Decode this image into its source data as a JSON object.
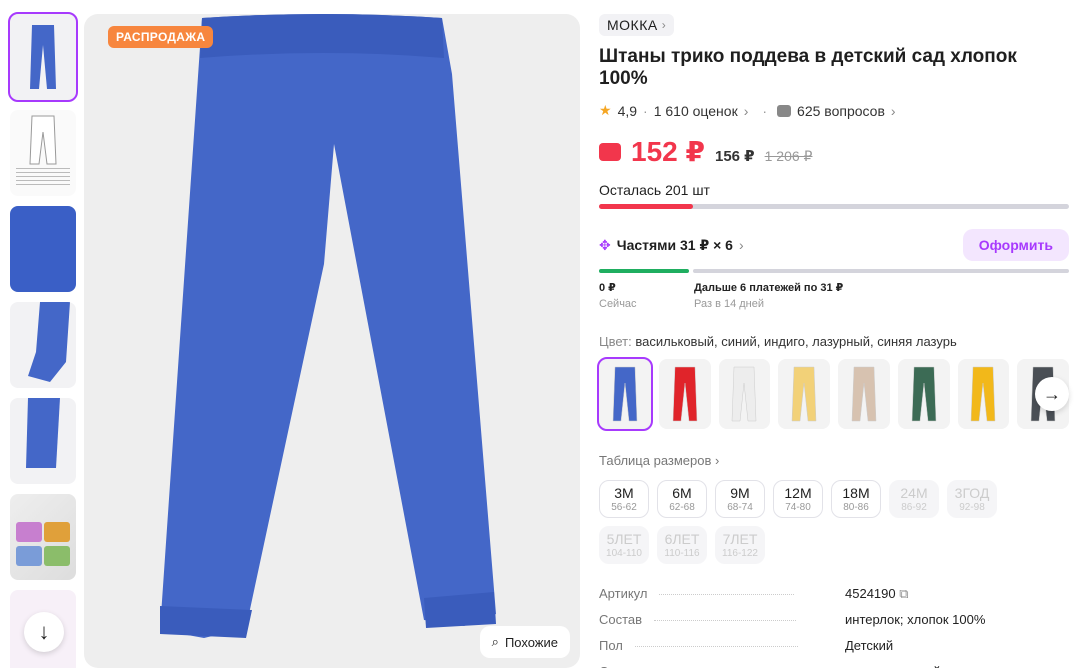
{
  "colors": {
    "accent": "#a73afd",
    "price": "#f2364c",
    "sale": "#f7863e",
    "pay_green": "#1fae60",
    "product_blue": "#4467c8"
  },
  "thumbnails": [
    "blue-pants",
    "size-chart",
    "fabric-closeup",
    "cuff-closeup",
    "cuff-closeup-2",
    "kids-photo-collage",
    "promo-card"
  ],
  "main_image": {
    "sale_badge": "РАСПРОДАЖА",
    "similar_button": "Похожие"
  },
  "brand": "МОККА",
  "title": "Штаны трико поддева в детский сад хлопок 100%",
  "rating": {
    "value": "4,9",
    "reviews": "1 610 оценок",
    "questions": "625 вопросов"
  },
  "price": {
    "current": "152 ₽",
    "alt": "156 ₽",
    "old": "1 206 ₽"
  },
  "stock": {
    "label": "Осталась 201 шт",
    "fraction": 0.2
  },
  "installments": {
    "label": "Частями 31 ₽ × 6",
    "button": "Оформить",
    "now_amount": "0 ₽",
    "now_label": "Сейчас",
    "later_amount": "Дальше 6 платежей по 31 ₽",
    "later_label": "Раз в 14 дней"
  },
  "color": {
    "key": "Цвет:",
    "value": "васильковый, синий, индиго, лазурный, синяя лазурь"
  },
  "swatches": [
    "#4467c8",
    "#e0242a",
    "#ededed",
    "#f2d178",
    "#d7c2b0",
    "#3c6b55",
    "#f2b81a",
    "#4a4f55"
  ],
  "size_table_label": "Таблица размеров",
  "sizes": [
    {
      "m": "3M",
      "r": "56-62",
      "available": true
    },
    {
      "m": "6M",
      "r": "62-68",
      "available": true
    },
    {
      "m": "9M",
      "r": "68-74",
      "available": true
    },
    {
      "m": "12M",
      "r": "74-80",
      "available": true
    },
    {
      "m": "18M",
      "r": "80-86",
      "available": true
    },
    {
      "m": "24M",
      "r": "86-92",
      "available": false
    },
    {
      "m": "3ГОД",
      "r": "92-98",
      "available": false
    },
    {
      "m": "5ЛЕТ",
      "r": "104-110",
      "available": false
    },
    {
      "m": "6ЛЕТ",
      "r": "110-116",
      "available": false
    },
    {
      "m": "7ЛЕТ",
      "r": "116-122",
      "available": false
    }
  ],
  "specs": [
    {
      "k": "Артикул",
      "v": "4524190"
    },
    {
      "k": "Состав",
      "v": "интерлок; хлопок 100%"
    },
    {
      "k": "Пол",
      "v": "Детский"
    },
    {
      "k": "Сезон",
      "v": "круглогодичный"
    }
  ]
}
